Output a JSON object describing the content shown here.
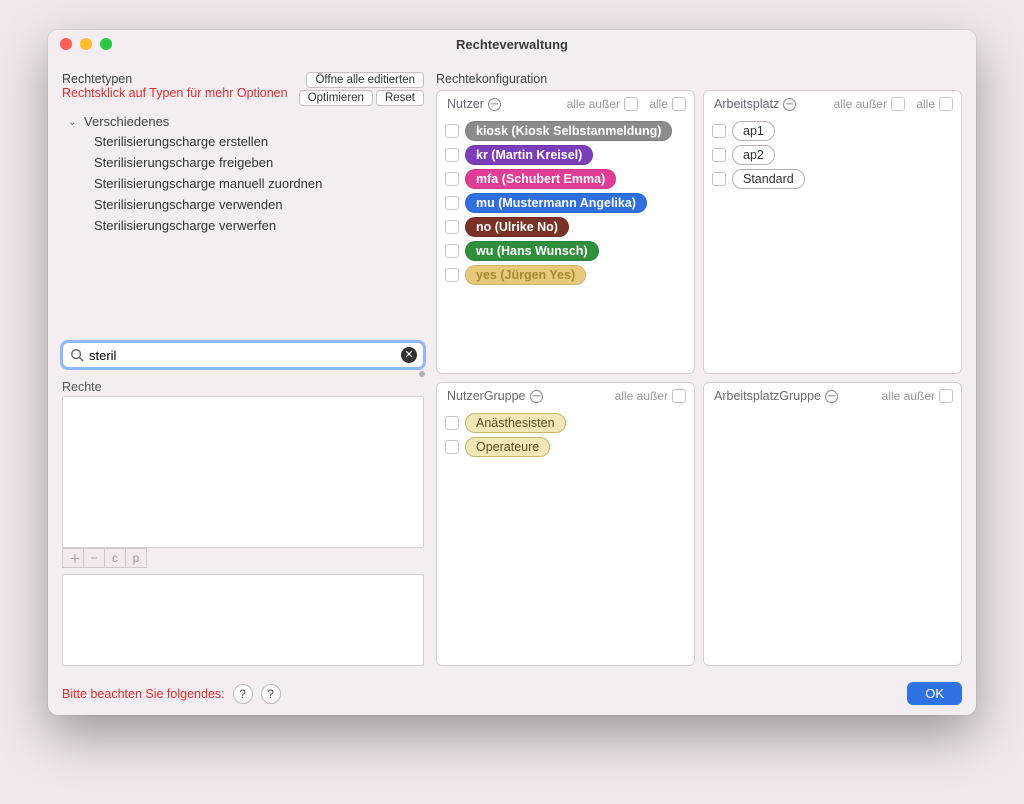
{
  "window": {
    "title": "Rechteverwaltung"
  },
  "left": {
    "label": "Rechtetypen",
    "hint": "Rechtsklick auf Typen für mehr Optionen",
    "buttons": {
      "open_all": "Öffne alle editierten",
      "optimize": "Optimieren",
      "reset": "Reset"
    },
    "tree": {
      "group": "Verschiedenes",
      "items": [
        "Sterilisierungscharge erstellen",
        "Sterilisierungscharge freigeben",
        "Sterilisierungscharge manuell zuordnen",
        "Sterilisierungscharge verwenden",
        "Sterilisierungscharge verwerfen"
      ]
    },
    "search": {
      "value": "steril"
    },
    "rechte_label": "Rechte",
    "tiny": {
      "plus": "＋",
      "minus": "−",
      "c": "c",
      "p": "p"
    }
  },
  "right": {
    "label": "Rechtekonfiguration",
    "panels": {
      "nutzer": {
        "title": "Nutzer",
        "alle_ausser": "alle außer",
        "alle": "alle",
        "items": [
          {
            "label": "kiosk (Kiosk Selbstanmeldung)",
            "cls": "pill-gray"
          },
          {
            "label": "kr (Martin Kreisel)",
            "cls": "pill-purple"
          },
          {
            "label": "mfa (Schubert Emma)",
            "cls": "pill-pink"
          },
          {
            "label": "mu (Mustermann Angelika)",
            "cls": "pill-blue"
          },
          {
            "label": "no (Ulrike No)",
            "cls": "pill-brown"
          },
          {
            "label": "wu (Hans Wunsch)",
            "cls": "pill-green"
          },
          {
            "label": "yes (Jürgen Yes)",
            "cls": "pill-sand"
          }
        ]
      },
      "arbeitsplatz": {
        "title": "Arbeitsplatz",
        "alle_ausser": "alle außer",
        "alle": "alle",
        "items": [
          {
            "label": "ap1"
          },
          {
            "label": "ap2"
          },
          {
            "label": "Standard"
          }
        ]
      },
      "nutzergruppe": {
        "title": "NutzerGruppe",
        "alle_ausser": "alle außer",
        "items": [
          {
            "label": "Anästhesisten"
          },
          {
            "label": "Operateure"
          }
        ]
      },
      "arbeitsplatzgruppe": {
        "title": "ArbeitsplatzGruppe",
        "alle_ausser": "alle außer",
        "items": []
      }
    }
  },
  "footer": {
    "warn": "Bitte beachten Sie folgendes:",
    "q": "?",
    "ok": "OK"
  }
}
